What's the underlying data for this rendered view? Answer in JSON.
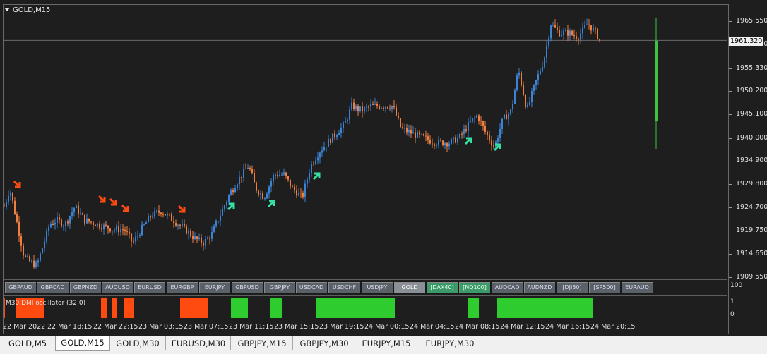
{
  "chart": {
    "title": "GOLD,M15",
    "current_price": "1961.320",
    "price_levels": [
      "1965.550",
      "1960.680",
      "1955.330",
      "1950.200",
      "1945.100",
      "1940.000",
      "1934.900",
      "1929.800",
      "1924.700",
      "1919.750",
      "1914.650",
      "1909.550"
    ],
    "colors": {
      "bull": "#3c83d4",
      "bear": "#f07e3c",
      "sell_arrow": "#ff4d12",
      "buy_arrow": "#34e0a0",
      "volume_bar": "#3ec43e"
    }
  },
  "symbols": [
    "GBPAUD",
    "GBPCAD",
    "GBPNZD",
    "AUDUSD",
    "EURUSD",
    "EURGBP",
    "EURJPY",
    "GBPUSD",
    "GBPJPY",
    "USDCAD",
    "USDCHF",
    "USDJPY",
    "GOLD",
    "[DAX40]",
    "[NQ100]",
    "AUDCAD",
    "AUDNZD",
    "[DJI30]",
    "[SP500]",
    "EURAUD"
  ],
  "active_symbol": "GOLD",
  "highlighted_symbols": [
    "[DAX40]",
    "[NQ100]"
  ],
  "indicator": {
    "label": "M30 DMI oscillator (32,0)",
    "scale_top": "100",
    "ticks": [
      "1",
      "0"
    ]
  },
  "time_labels": [
    "22 Mar 2022",
    "22 Mar 18:15",
    "22 Mar 22:15",
    "23 Mar 03:15",
    "23 Mar 07:15",
    "23 Mar 11:15",
    "23 Mar 15:15",
    "23 Mar 19:15",
    "24 Mar 00:15",
    "24 Mar 04:15",
    "24 Mar 08:15",
    "24 Mar 12:15",
    "24 Mar 16:15",
    "24 Mar 20:15"
  ],
  "tabs": [
    "GOLD,M5",
    "GOLD,M15",
    "GOLD,M30",
    "EURUSD,M30",
    "GBPJPY,M15",
    "GBPJPY,M30",
    "EURJPY,M15",
    "EURJPY,M30"
  ],
  "active_tab": "GOLD,M15"
}
